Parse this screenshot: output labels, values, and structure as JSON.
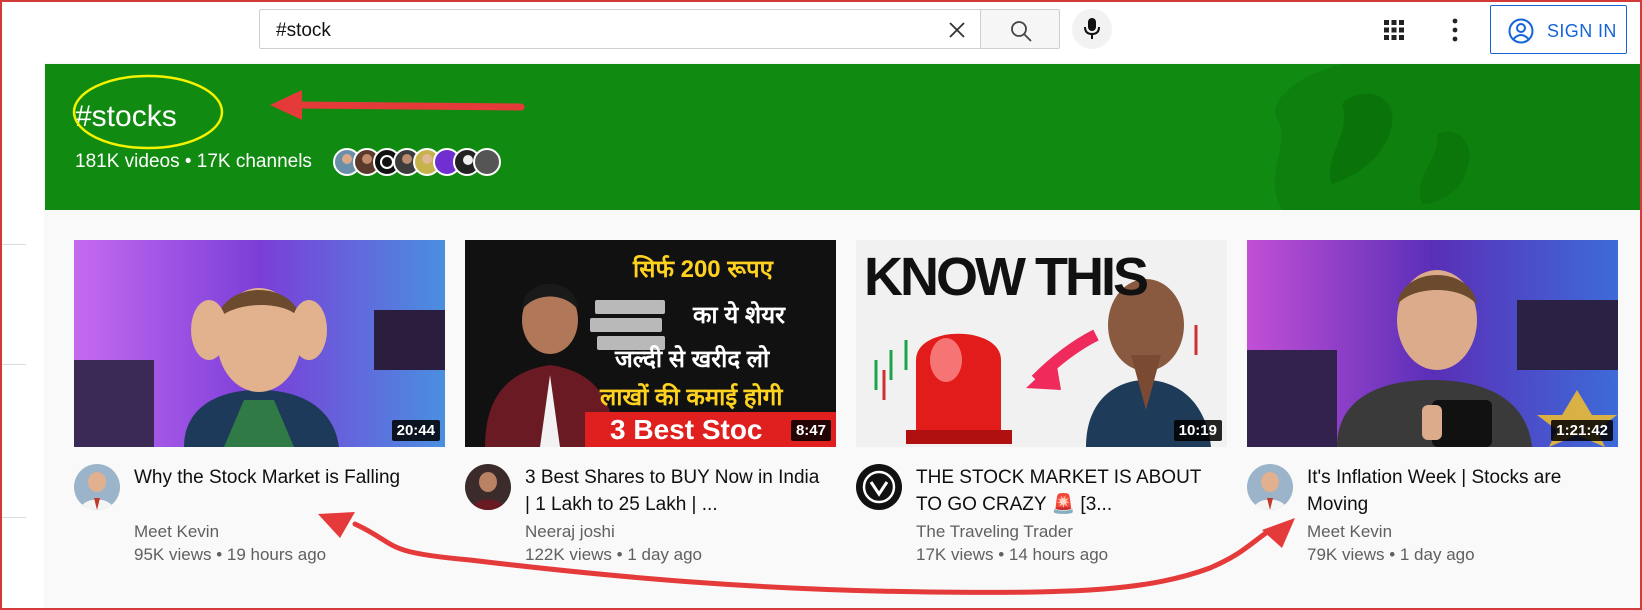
{
  "search": {
    "query": "#stock"
  },
  "header": {
    "sign_in_label": "SIGN IN"
  },
  "hashtag": {
    "title": "#stocks",
    "stats": "181K videos • 17K channels",
    "banner_color": "#108a10"
  },
  "videos": [
    {
      "duration": "20:44",
      "title": "Why the Stock Market is Falling",
      "channel": "Meet Kevin",
      "meta": "95K views • 19 hours ago"
    },
    {
      "duration": "8:47",
      "title": "3 Best Shares to BUY Now in India | 1 Lakh to 25 Lakh | ...",
      "channel": "Neeraj joshi",
      "meta": "122K views • 1 day ago",
      "thumb_lines": [
        "सिर्फ 200 रूपए",
        "का ये शेयर",
        "जल्दी से खरीद लो",
        "लाखों की कमाई होगी",
        "3 Best Stoc"
      ]
    },
    {
      "duration": "10:19",
      "title": "THE STOCK MARKET IS ABOUT TO GO CRAZY 🚨 [3...",
      "channel": "The Traveling Trader",
      "meta": "17K views • 14 hours ago",
      "thumb_lines": [
        "KNOW THIS"
      ]
    },
    {
      "duration": "1:21:42",
      "title": "It's Inflation Week | Stocks are Moving",
      "channel": "Meet Kevin",
      "meta": "79K views • 1 day ago"
    }
  ],
  "colors": {
    "accent_blue": "#1565d8",
    "annotation_red": "#e53a3a",
    "annotation_yellow": "#ffff00"
  }
}
